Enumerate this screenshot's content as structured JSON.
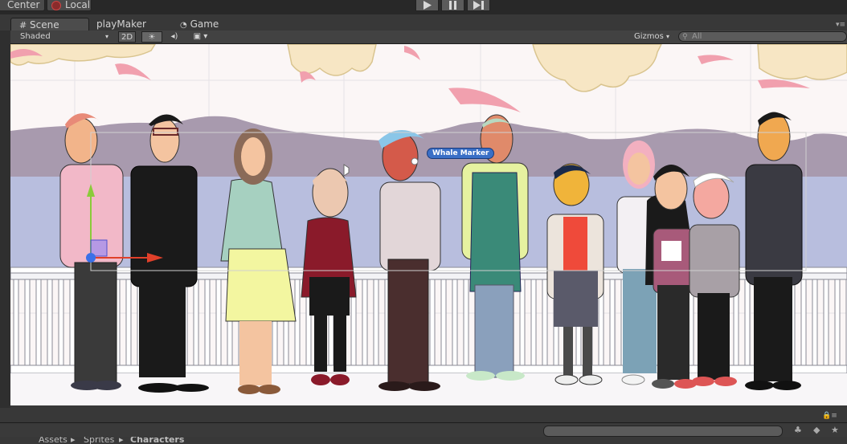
{
  "toolbar": {
    "pivot_center_label": "Center",
    "pivot_local_label": "Local"
  },
  "tabs": {
    "scene": "Scene",
    "playmaker": "playMaker",
    "game": "Game"
  },
  "scene_toolbar": {
    "shading_mode": "Shaded",
    "mode_2d_label": "2D",
    "gizmos_label": "Gizmos",
    "search_placeholder": "All"
  },
  "viewport": {
    "selected_object_label": "Whale Marker"
  },
  "breadcrumb": [
    "Assets",
    "Sprites",
    "Characters"
  ],
  "colors": {
    "editor_bg": "#383838",
    "sky": "#fbf6f6",
    "lake": "#b8bede",
    "mountains": "#a89aae",
    "railing": "#ffffff",
    "label_blue": "#3a6fc6",
    "gizmo_x": "#e0402a",
    "gizmo_y": "#8acb3a"
  }
}
